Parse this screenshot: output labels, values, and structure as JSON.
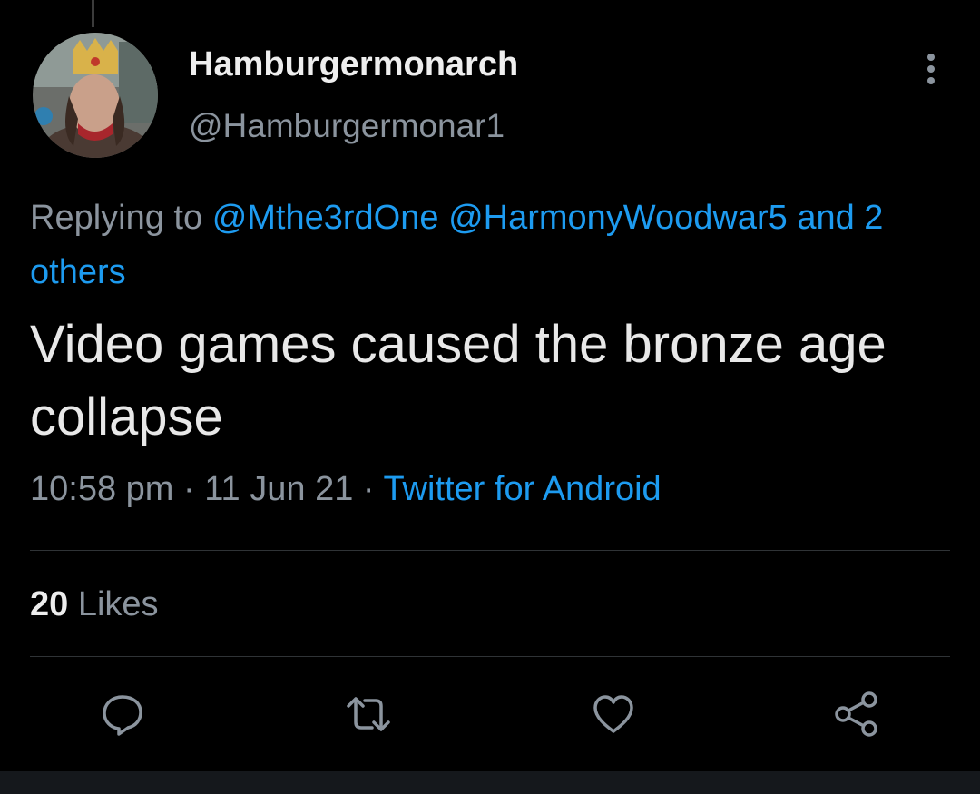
{
  "tweet": {
    "display_name": "Hamburgermonarch",
    "handle": "@Hamburgermonar1",
    "replying_prefix": "Replying to",
    "mentions": [
      "@Mthe3rdOne",
      "@HarmonyWoodwar5"
    ],
    "others_text": "and 2 others",
    "text": "Video games caused the bronze age collapse",
    "time": "10:58 pm",
    "date": "11 Jun 21",
    "separator": "·",
    "source": "Twitter for Android",
    "likes_count": "20",
    "likes_label": "Likes"
  },
  "icons": {
    "more": "more-vertical-icon",
    "reply": "reply-bubble-icon",
    "retweet": "retweet-icon",
    "like": "heart-icon",
    "share": "share-icon"
  },
  "colors": {
    "background": "#000000",
    "text": "#e6e6e6",
    "secondary": "#8b949e",
    "link": "#1d9bf0",
    "divider": "#2f3336"
  }
}
